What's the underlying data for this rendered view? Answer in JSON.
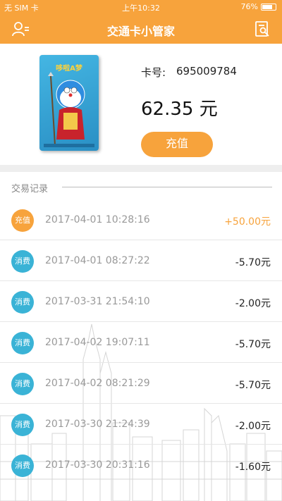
{
  "status_bar": {
    "carrier": "无 SIM 卡",
    "time": "上午10:32",
    "battery": "76%"
  },
  "nav": {
    "title": "交通卡小管家",
    "left_icon": "user-icon",
    "right_icon": "document-search-icon"
  },
  "card": {
    "number_label": "卡号:",
    "number": "695009784",
    "balance": "62.35 元",
    "recharge_label": "充值",
    "brand_text": "哆啦A梦"
  },
  "records": {
    "title": "交易记录",
    "items": [
      {
        "type": "充值",
        "kind": "recharge",
        "time": "2017-04-01 10:28:16",
        "amount": "+50.00元"
      },
      {
        "type": "消费",
        "kind": "consume",
        "time": "2017-04-01 08:27:22",
        "amount": "-5.70元"
      },
      {
        "type": "消费",
        "kind": "consume",
        "time": "2017-03-31 21:54:10",
        "amount": "-2.00元"
      },
      {
        "type": "消费",
        "kind": "consume",
        "time": "2017-04-02 19:07:11",
        "amount": "-5.70元"
      },
      {
        "type": "消费",
        "kind": "consume",
        "time": "2017-04-02 08:21:29",
        "amount": "-5.70元"
      },
      {
        "type": "消费",
        "kind": "consume",
        "time": "2017-03-30 21:24:39",
        "amount": "-2.00元"
      },
      {
        "type": "消费",
        "kind": "consume",
        "time": "2017-03-30 20:31:16",
        "amount": "-1.60元"
      }
    ]
  },
  "colors": {
    "accent": "#f7a33c",
    "consume_badge": "#3ab3d6"
  }
}
